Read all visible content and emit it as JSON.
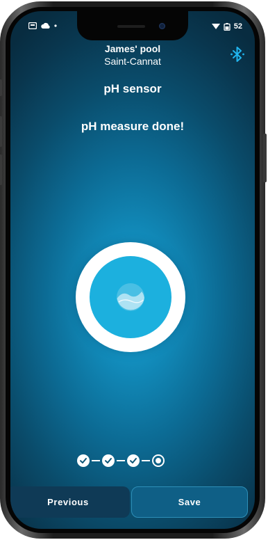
{
  "status_bar": {
    "time": "52"
  },
  "header": {
    "pool_name": "James' pool",
    "location": "Saint-Cannat",
    "bluetooth_icon": "bluetooth-icon",
    "accent_color": "#21b6f0"
  },
  "sensor": {
    "title": "pH sensor",
    "status": "pH measure done!",
    "icon": "water-wave-icon"
  },
  "progress": {
    "total_steps": 4,
    "completed_steps": 3,
    "current_step": 4
  },
  "actions": {
    "previous_label": "Previous",
    "save_label": "Save"
  }
}
